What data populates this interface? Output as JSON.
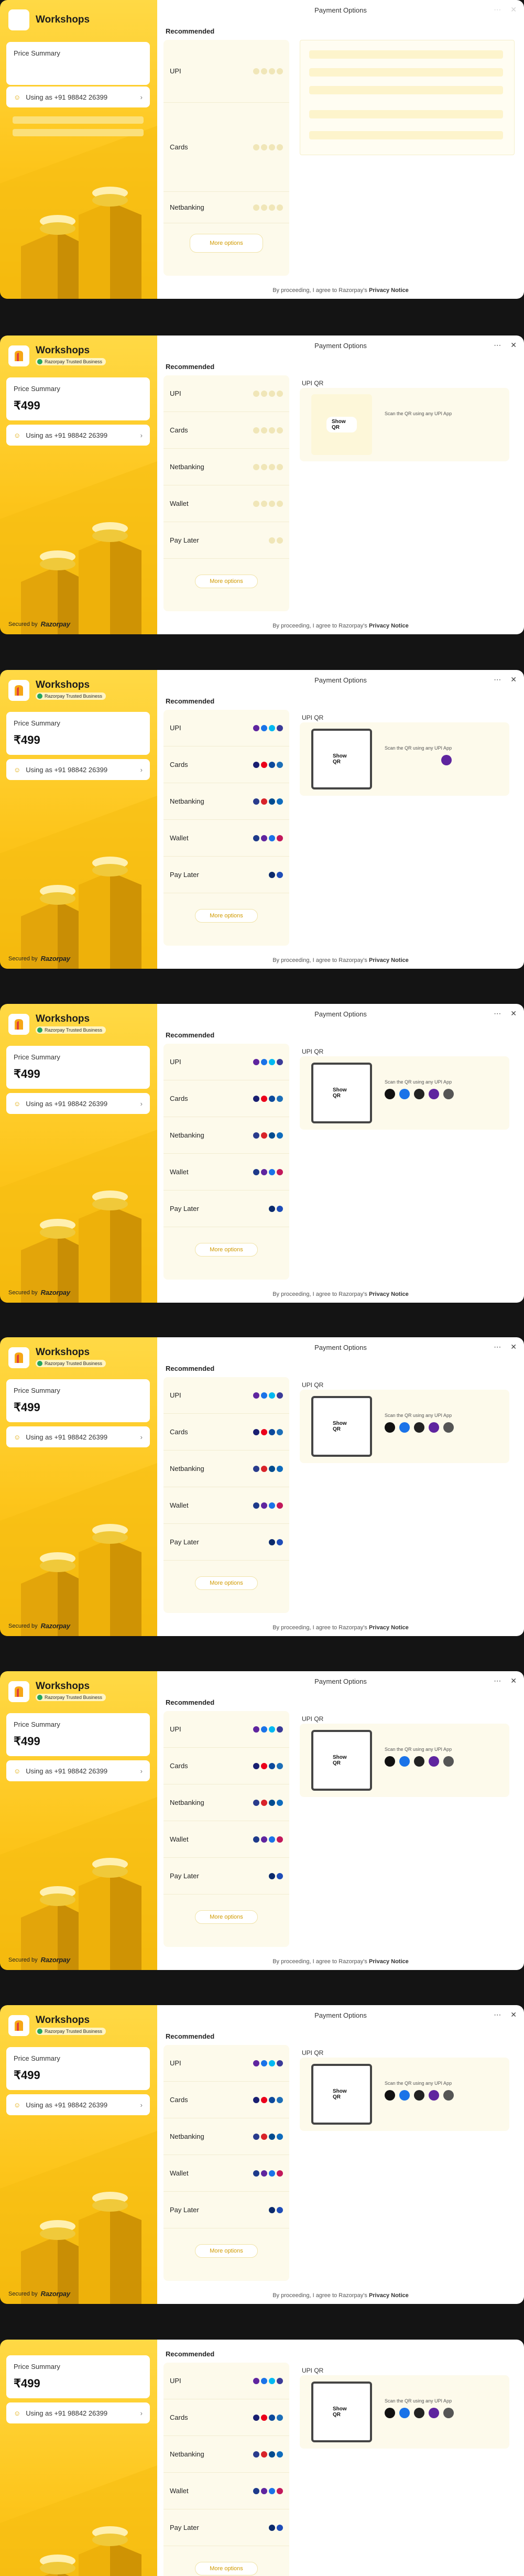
{
  "merchant": {
    "name": "Workshops",
    "badge": "Razorpay Trusted Business"
  },
  "price": {
    "label": "Price Summary",
    "amount": "₹499"
  },
  "user": {
    "label": "Using as +91 98842 26399"
  },
  "secured": {
    "prefix": "Secured by",
    "brand": "Razorpay"
  },
  "window": {
    "title": "Payment Options"
  },
  "recommended": "Recommended",
  "methods": [
    "UPI",
    "Cards",
    "Netbanking",
    "Wallet",
    "Pay Later"
  ],
  "more_options": "More options",
  "qr": {
    "heading": "UPI QR",
    "show_label": "Show QR",
    "scan_text": "Scan the QR using any UPI App"
  },
  "footer": {
    "text": "By proceeding, I agree to Razorpay's",
    "link": "Privacy Notice"
  },
  "colors": {
    "brand_yellow": "#fdc51b",
    "accent": "#d09a00",
    "panel": "#fdfaeb"
  },
  "icons": [
    "more-icon",
    "close-icon",
    "user-icon",
    "chevron-right-icon"
  ],
  "frames": [
    {
      "state": "loading"
    },
    {
      "state": "qr-loading"
    },
    {
      "state": "qr-shown-single-app"
    },
    {
      "state": "qr-shown-apps"
    },
    {
      "state": "qr-shown-apps"
    },
    {
      "state": "qr-shown-apps"
    },
    {
      "state": "qr-shown-apps"
    },
    {
      "state": "qr-shown-apps-scrolled"
    }
  ]
}
